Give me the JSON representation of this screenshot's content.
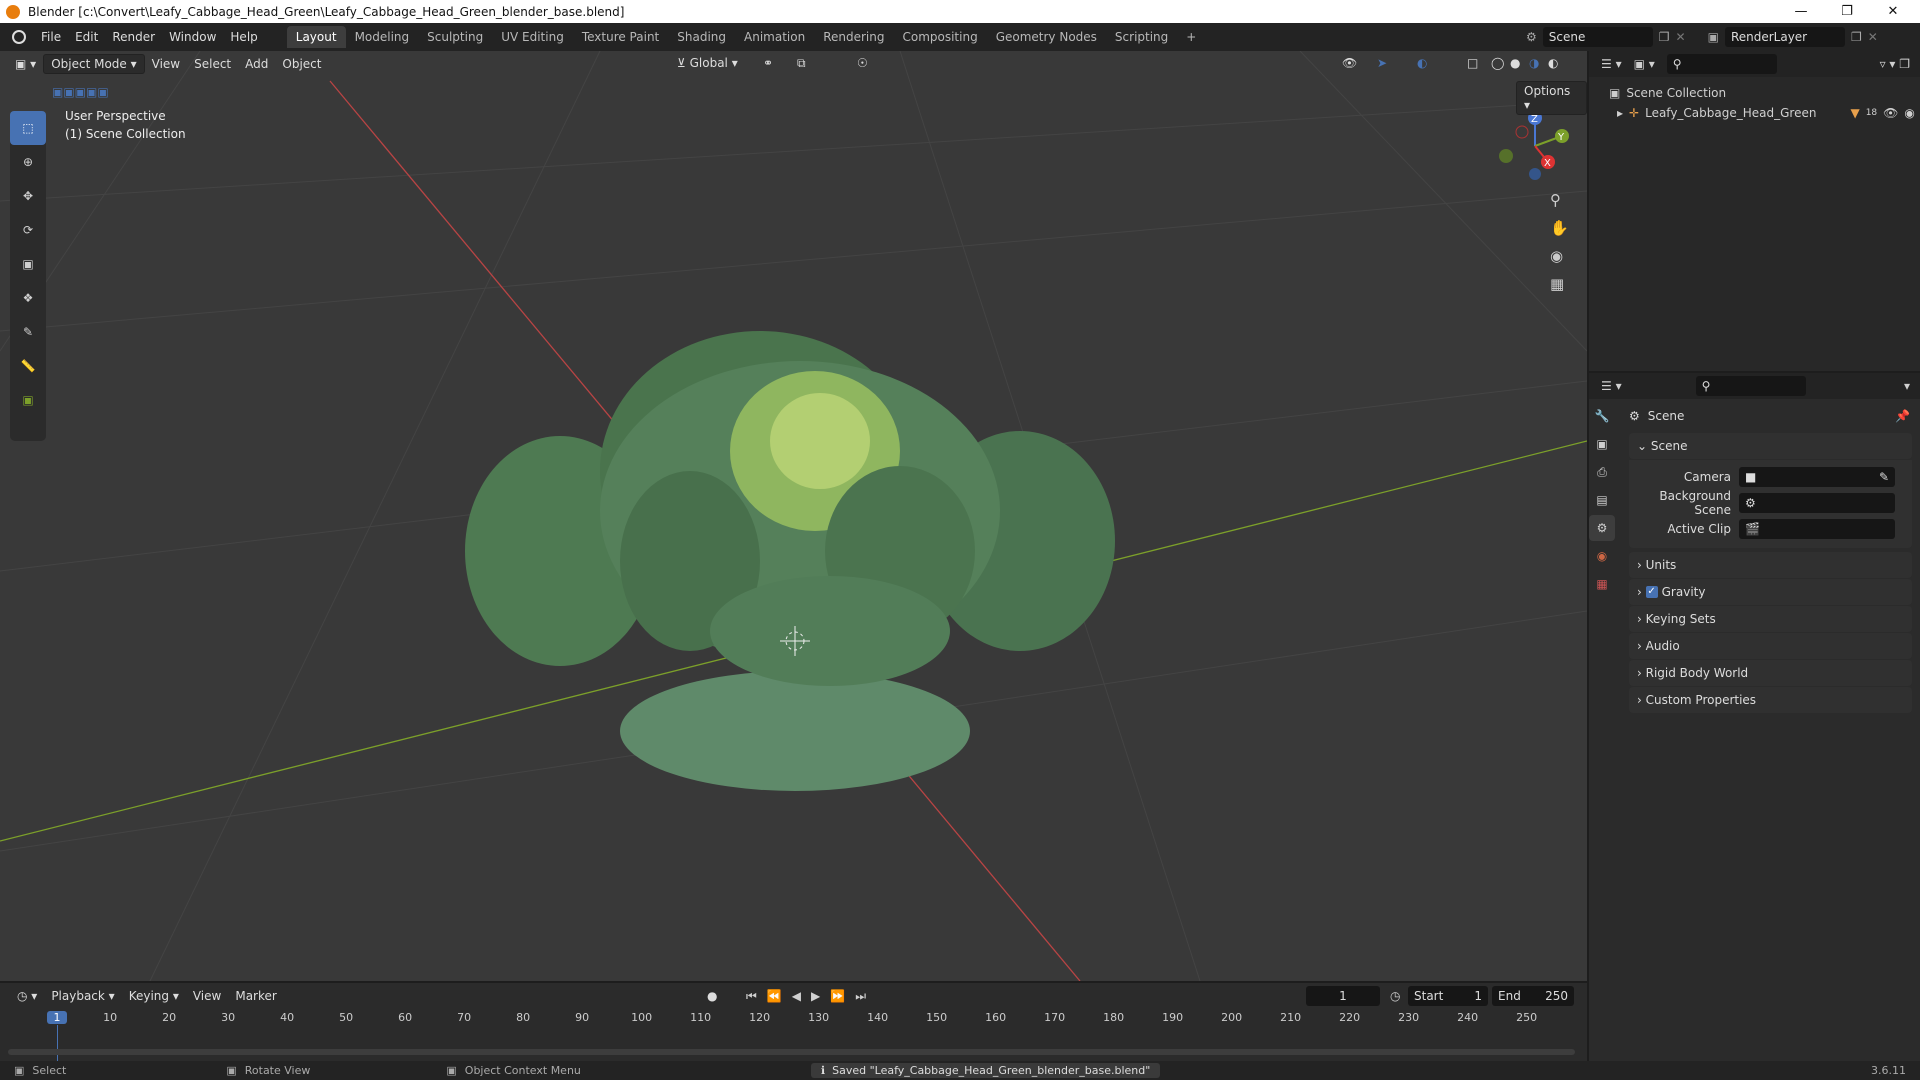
{
  "window": {
    "title": "Blender [c:\\Convert\\Leafy_Cabbage_Head_Green\\Leafy_Cabbage_Head_Green_blender_base.blend]"
  },
  "menus": [
    "File",
    "Edit",
    "Render",
    "Window",
    "Help"
  ],
  "workspaces": [
    "Layout",
    "Modeling",
    "Sculpting",
    "UV Editing",
    "Texture Paint",
    "Shading",
    "Animation",
    "Rendering",
    "Compositing",
    "Geometry Nodes",
    "Scripting"
  ],
  "scene_field": "Scene",
  "renderlayer_field": "RenderLayer",
  "viewport": {
    "mode": "Object Mode",
    "menus": [
      "View",
      "Select",
      "Add",
      "Object"
    ],
    "transform": "Global",
    "options": "Options",
    "perspective": "User Perspective",
    "collection": "(1) Scene Collection",
    "gizmo": {
      "x": "X",
      "y": "Y",
      "z": "Z"
    }
  },
  "outliner": {
    "root": "Scene Collection",
    "item": "Leafy_Cabbage_Head_Green",
    "item_badge": "18"
  },
  "properties": {
    "header": "Scene",
    "section": "Scene",
    "fields": [
      {
        "label": "Camera"
      },
      {
        "label": "Background Scene"
      },
      {
        "label": "Active Clip"
      }
    ],
    "panels": [
      "Units",
      "Gravity",
      "Keying Sets",
      "Audio",
      "Rigid Body World",
      "Custom Properties"
    ],
    "gravity_checked": true
  },
  "timeline": {
    "menus": [
      "Playback",
      "Keying",
      "View",
      "Marker"
    ],
    "current_frame": "1",
    "start_label": "Start",
    "start": "1",
    "end_label": "End",
    "end": "250",
    "ticks": [
      "1",
      "10",
      "20",
      "30",
      "40",
      "50",
      "60",
      "70",
      "80",
      "90",
      "100",
      "110",
      "120",
      "130",
      "140",
      "150",
      "160",
      "170",
      "180",
      "190",
      "200",
      "210",
      "220",
      "230",
      "240",
      "250"
    ]
  },
  "status": {
    "select": "Select",
    "rotate": "Rotate View",
    "context": "Object Context Menu",
    "message": "Saved \"Leafy_Cabbage_Head_Green_blender_base.blend\"",
    "version": "3.6.11"
  },
  "colors": {
    "accent": "#4772b3",
    "x_axis": "#c0392b",
    "y_axis": "#7ca02a",
    "leaf": "#4e7a52"
  }
}
